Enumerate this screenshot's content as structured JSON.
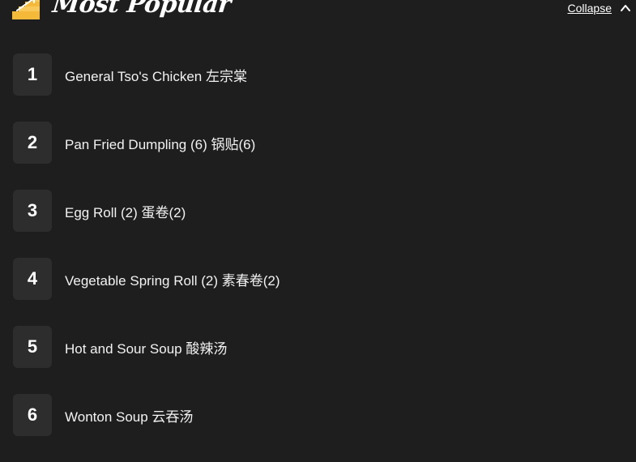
{
  "header": {
    "title": "Most Popular",
    "collapse_label": "Collapse",
    "icon": "stairs-icon"
  },
  "colors": {
    "background": "#1e1e1e",
    "rank_box": "#2d2d2d",
    "text": "#ffffff"
  },
  "items": [
    {
      "rank": "1",
      "name": "General Tso's Chicken 左宗棠"
    },
    {
      "rank": "2",
      "name": "Pan Fried Dumpling (6) 锅贴(6)"
    },
    {
      "rank": "3",
      "name": "Egg Roll (2) 蛋卷(2)"
    },
    {
      "rank": "4",
      "name": "Vegetable Spring Roll (2) 素春卷(2)"
    },
    {
      "rank": "5",
      "name": "Hot and Sour Soup 酸辣汤"
    },
    {
      "rank": "6",
      "name": "Wonton Soup 云吞汤"
    }
  ]
}
